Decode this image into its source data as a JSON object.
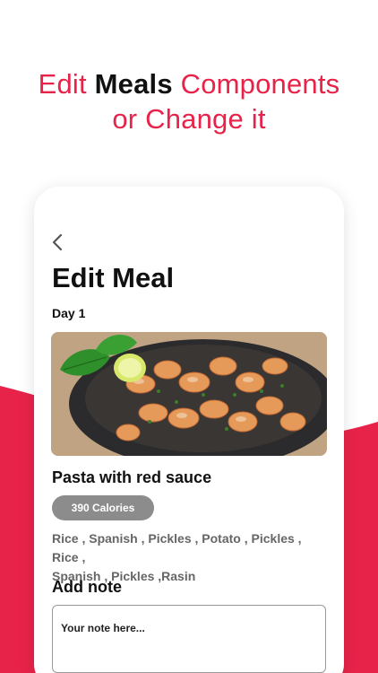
{
  "headline": {
    "part1": "Edit ",
    "part2": "Meals",
    "part3": " Components",
    "line2": "or Change it"
  },
  "screen": {
    "title": "Edit Meal",
    "day": "Day 1",
    "meal_name": "Pasta with red sauce",
    "calories": "390 Calories",
    "components_line1": "Rice , Spanish , Pickles , Potato , Pickles , Rice ,",
    "components_line2": "Spanish , Pickles ,Rasin",
    "note_label": "Add note",
    "note_placeholder": "Your note here..."
  },
  "colors": {
    "accent": "#e8234a",
    "text": "#111111",
    "badge": "#8c8c8c"
  },
  "icons": {
    "back": "chevron-left-icon"
  }
}
